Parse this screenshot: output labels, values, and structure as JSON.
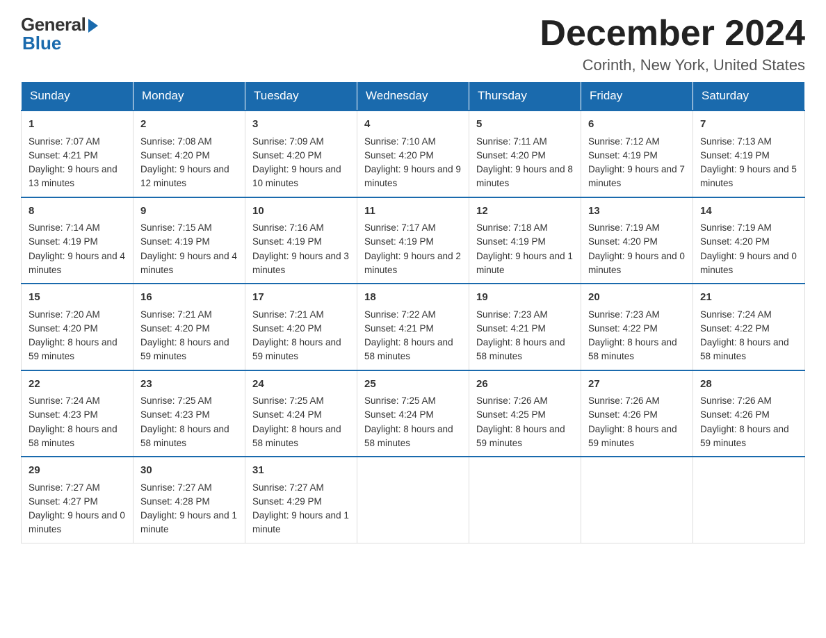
{
  "logo": {
    "general": "General",
    "blue": "Blue"
  },
  "title": "December 2024",
  "location": "Corinth, New York, United States",
  "days": [
    "Sunday",
    "Monday",
    "Tuesday",
    "Wednesday",
    "Thursday",
    "Friday",
    "Saturday"
  ],
  "weeks": [
    [
      {
        "day": "1",
        "sunrise": "7:07 AM",
        "sunset": "4:21 PM",
        "daylight": "9 hours and 13 minutes."
      },
      {
        "day": "2",
        "sunrise": "7:08 AM",
        "sunset": "4:20 PM",
        "daylight": "9 hours and 12 minutes."
      },
      {
        "day": "3",
        "sunrise": "7:09 AM",
        "sunset": "4:20 PM",
        "daylight": "9 hours and 10 minutes."
      },
      {
        "day": "4",
        "sunrise": "7:10 AM",
        "sunset": "4:20 PM",
        "daylight": "9 hours and 9 minutes."
      },
      {
        "day": "5",
        "sunrise": "7:11 AM",
        "sunset": "4:20 PM",
        "daylight": "9 hours and 8 minutes."
      },
      {
        "day": "6",
        "sunrise": "7:12 AM",
        "sunset": "4:19 PM",
        "daylight": "9 hours and 7 minutes."
      },
      {
        "day": "7",
        "sunrise": "7:13 AM",
        "sunset": "4:19 PM",
        "daylight": "9 hours and 5 minutes."
      }
    ],
    [
      {
        "day": "8",
        "sunrise": "7:14 AM",
        "sunset": "4:19 PM",
        "daylight": "9 hours and 4 minutes."
      },
      {
        "day": "9",
        "sunrise": "7:15 AM",
        "sunset": "4:19 PM",
        "daylight": "9 hours and 4 minutes."
      },
      {
        "day": "10",
        "sunrise": "7:16 AM",
        "sunset": "4:19 PM",
        "daylight": "9 hours and 3 minutes."
      },
      {
        "day": "11",
        "sunrise": "7:17 AM",
        "sunset": "4:19 PM",
        "daylight": "9 hours and 2 minutes."
      },
      {
        "day": "12",
        "sunrise": "7:18 AM",
        "sunset": "4:19 PM",
        "daylight": "9 hours and 1 minute."
      },
      {
        "day": "13",
        "sunrise": "7:19 AM",
        "sunset": "4:20 PM",
        "daylight": "9 hours and 0 minutes."
      },
      {
        "day": "14",
        "sunrise": "7:19 AM",
        "sunset": "4:20 PM",
        "daylight": "9 hours and 0 minutes."
      }
    ],
    [
      {
        "day": "15",
        "sunrise": "7:20 AM",
        "sunset": "4:20 PM",
        "daylight": "8 hours and 59 minutes."
      },
      {
        "day": "16",
        "sunrise": "7:21 AM",
        "sunset": "4:20 PM",
        "daylight": "8 hours and 59 minutes."
      },
      {
        "day": "17",
        "sunrise": "7:21 AM",
        "sunset": "4:20 PM",
        "daylight": "8 hours and 59 minutes."
      },
      {
        "day": "18",
        "sunrise": "7:22 AM",
        "sunset": "4:21 PM",
        "daylight": "8 hours and 58 minutes."
      },
      {
        "day": "19",
        "sunrise": "7:23 AM",
        "sunset": "4:21 PM",
        "daylight": "8 hours and 58 minutes."
      },
      {
        "day": "20",
        "sunrise": "7:23 AM",
        "sunset": "4:22 PM",
        "daylight": "8 hours and 58 minutes."
      },
      {
        "day": "21",
        "sunrise": "7:24 AM",
        "sunset": "4:22 PM",
        "daylight": "8 hours and 58 minutes."
      }
    ],
    [
      {
        "day": "22",
        "sunrise": "7:24 AM",
        "sunset": "4:23 PM",
        "daylight": "8 hours and 58 minutes."
      },
      {
        "day": "23",
        "sunrise": "7:25 AM",
        "sunset": "4:23 PM",
        "daylight": "8 hours and 58 minutes."
      },
      {
        "day": "24",
        "sunrise": "7:25 AM",
        "sunset": "4:24 PM",
        "daylight": "8 hours and 58 minutes."
      },
      {
        "day": "25",
        "sunrise": "7:25 AM",
        "sunset": "4:24 PM",
        "daylight": "8 hours and 58 minutes."
      },
      {
        "day": "26",
        "sunrise": "7:26 AM",
        "sunset": "4:25 PM",
        "daylight": "8 hours and 59 minutes."
      },
      {
        "day": "27",
        "sunrise": "7:26 AM",
        "sunset": "4:26 PM",
        "daylight": "8 hours and 59 minutes."
      },
      {
        "day": "28",
        "sunrise": "7:26 AM",
        "sunset": "4:26 PM",
        "daylight": "8 hours and 59 minutes."
      }
    ],
    [
      {
        "day": "29",
        "sunrise": "7:27 AM",
        "sunset": "4:27 PM",
        "daylight": "9 hours and 0 minutes."
      },
      {
        "day": "30",
        "sunrise": "7:27 AM",
        "sunset": "4:28 PM",
        "daylight": "9 hours and 1 minute."
      },
      {
        "day": "31",
        "sunrise": "7:27 AM",
        "sunset": "4:29 PM",
        "daylight": "9 hours and 1 minute."
      },
      null,
      null,
      null,
      null
    ]
  ],
  "labels": {
    "sunrise": "Sunrise:",
    "sunset": "Sunset:",
    "daylight": "Daylight:"
  }
}
